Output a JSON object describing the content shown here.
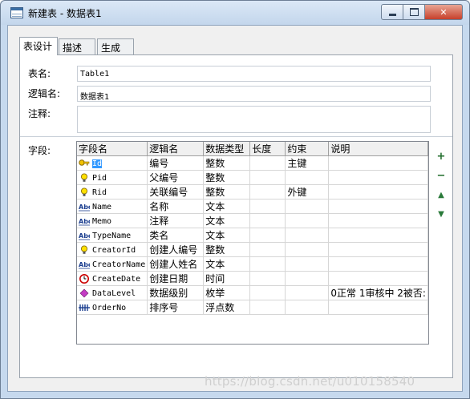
{
  "window": {
    "title": "新建表 - 数据表1",
    "close_glyph": "✕"
  },
  "tabs": [
    {
      "label": "表设计"
    },
    {
      "label": "描述"
    },
    {
      "label": "生成"
    }
  ],
  "form": {
    "table_name_label": "表名:",
    "table_name_value": "Table1",
    "logical_name_label": "逻辑名:",
    "logical_name_value": "数据表1",
    "comment_label": "注释:",
    "comment_value": "",
    "fields_label": "字段:"
  },
  "grid": {
    "columns": [
      "字段名",
      "逻辑名",
      "数据类型",
      "长度",
      "约束",
      "说明"
    ],
    "rows": [
      {
        "icon": "key-icon",
        "name": "Id",
        "logical": "编号",
        "type": "整数",
        "length": "",
        "constraint": "主键",
        "desc": "",
        "selected": true
      },
      {
        "icon": "bulb-icon",
        "name": "Pid",
        "logical": "父编号",
        "type": "整数",
        "length": "",
        "constraint": "",
        "desc": ""
      },
      {
        "icon": "bulb-icon",
        "name": "Rid",
        "logical": "关联编号",
        "type": "整数",
        "length": "",
        "constraint": "外键",
        "desc": ""
      },
      {
        "icon": "text-type-icon",
        "name": "Name",
        "logical": "名称",
        "type": "文本",
        "length": "",
        "constraint": "",
        "desc": ""
      },
      {
        "icon": "text-type-icon",
        "name": "Memo",
        "logical": "注释",
        "type": "文本",
        "length": "",
        "constraint": "",
        "desc": ""
      },
      {
        "icon": "text-type-icon",
        "name": "TypeName",
        "logical": "类名",
        "type": "文本",
        "length": "",
        "constraint": "",
        "desc": ""
      },
      {
        "icon": "bulb-icon",
        "name": "CreatorId",
        "logical": "创建人编号",
        "type": "整数",
        "length": "",
        "constraint": "",
        "desc": ""
      },
      {
        "icon": "text-type-icon",
        "name": "CreatorName",
        "logical": "创建人姓名",
        "type": "文本",
        "length": "",
        "constraint": "",
        "desc": ""
      },
      {
        "icon": "clock-icon",
        "name": "CreateDate",
        "logical": "创建日期",
        "type": "时间",
        "length": "",
        "constraint": "",
        "desc": ""
      },
      {
        "icon": "enum-icon",
        "name": "DataLevel",
        "logical": "数据级别",
        "type": "枚举",
        "length": "",
        "constraint": "",
        "desc": "0正常 1审核中 2被否:"
      },
      {
        "icon": "number-icon",
        "name": "OrderNo",
        "logical": "排序号",
        "type": "浮点数",
        "length": "",
        "constraint": "",
        "desc": ""
      }
    ]
  },
  "side_buttons": {
    "add": "+",
    "remove": "−",
    "up": "▲",
    "down": "▼"
  },
  "watermark": "https://blog.csdn.net/u010158540",
  "colors": {
    "selection": "#3399ff",
    "add_remove": "#1f6b2a",
    "arrows": "#2a7a3a"
  }
}
